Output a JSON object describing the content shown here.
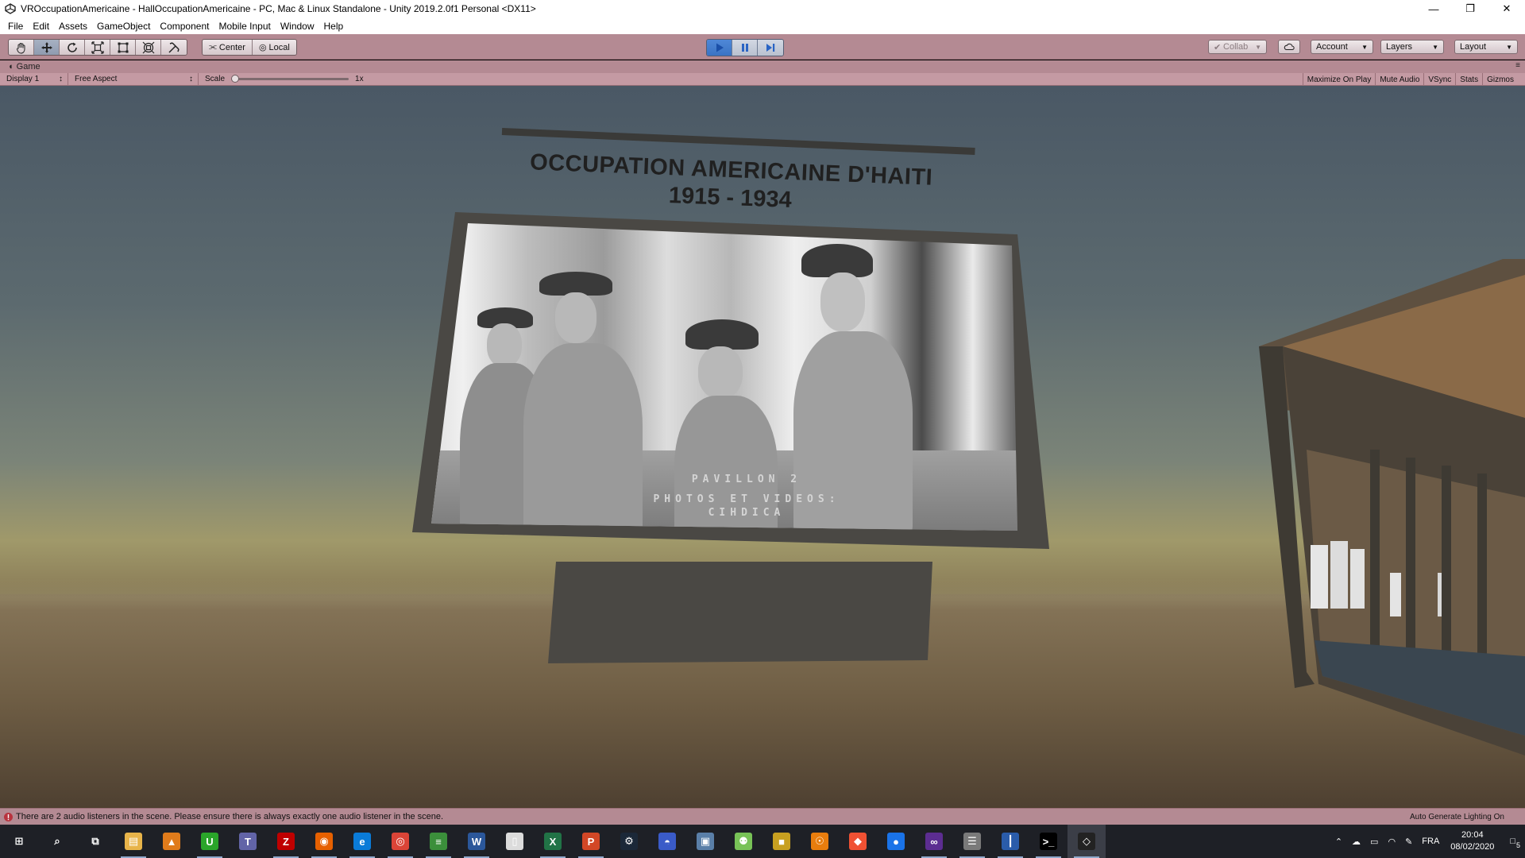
{
  "window": {
    "title": "VROccupationAmericaine - HallOccupationAmericaine - PC, Mac & Linux Standalone - Unity 2019.2.0f1 Personal <DX11>",
    "controls": {
      "minimize": "—",
      "restore": "❐",
      "close": "✕"
    }
  },
  "menubar": {
    "items": [
      "File",
      "Edit",
      "Assets",
      "GameObject",
      "Component",
      "Mobile Input",
      "Window",
      "Help"
    ]
  },
  "toolbar": {
    "tools": [
      "hand-tool",
      "move-tool",
      "rotate-tool",
      "scale-tool",
      "rect-tool",
      "transform-tool",
      "custom-tool"
    ],
    "active_tool": "move-tool",
    "pivot": "Center",
    "space": "Local",
    "play_active": true,
    "collab": "Collab",
    "account": "Account",
    "layers": "Layers",
    "layout": "Layout"
  },
  "game_tab": {
    "label": "Game"
  },
  "game_bar": {
    "display": "Display 1",
    "aspect": "Free Aspect",
    "scale_label": "Scale",
    "scale_value": "1x",
    "scale_level": 0,
    "toggles": [
      "Maximize On Play",
      "Mute Audio",
      "VSync",
      "Stats",
      "Gizmos"
    ]
  },
  "scene": {
    "sign_title_line1": "OCCUPATION AMERICAINE D'HAITI",
    "sign_title_line2": "1915 - 1934",
    "plaque_line1": "PAVILLON 2",
    "plaque_line2": "PHOTOS ET VIDEOS:",
    "plaque_line3": "CIHDICA"
  },
  "statusbar": {
    "message": "There are 2 audio listeners in the scene. Please ensure there is always exactly one audio listener in the scene.",
    "right": "Auto Generate Lighting On"
  },
  "taskbar": {
    "apps": [
      {
        "name": "start-icon",
        "glyph": "⊞",
        "color": "#1e2026"
      },
      {
        "name": "search-icon",
        "glyph": "⌕",
        "color": "#1e2026"
      },
      {
        "name": "task-view-icon",
        "glyph": "⧉",
        "color": "#1e2026"
      },
      {
        "name": "file-explorer-icon",
        "glyph": "▤",
        "color": "#e8b44a"
      },
      {
        "name": "vlc-cone-icon",
        "glyph": "▲",
        "color": "#e07b1b"
      },
      {
        "name": "upwork-icon",
        "glyph": "U",
        "color": "#2aa52a"
      },
      {
        "name": "teams-icon",
        "glyph": "T",
        "color": "#6264a7"
      },
      {
        "name": "filezilla-icon",
        "glyph": "Z",
        "color": "#bf0000"
      },
      {
        "name": "firefox-icon",
        "glyph": "◉",
        "color": "#e66000"
      },
      {
        "name": "edge-icon",
        "glyph": "e",
        "color": "#0a7bd8"
      },
      {
        "name": "chrome-icon",
        "glyph": "◎",
        "color": "#db4437"
      },
      {
        "name": "project-icon",
        "glyph": "≡",
        "color": "#3b8f3b"
      },
      {
        "name": "word-icon",
        "glyph": "W",
        "color": "#2b579a"
      },
      {
        "name": "blank-file-icon",
        "glyph": "▯",
        "color": "#dcdcdc"
      },
      {
        "name": "excel-icon",
        "glyph": "X",
        "color": "#217346"
      },
      {
        "name": "powerpoint-icon",
        "glyph": "P",
        "color": "#d24726"
      },
      {
        "name": "steam-icon",
        "glyph": "⚙",
        "color": "#1b2838"
      },
      {
        "name": "oculus-icon",
        "glyph": "◓",
        "color": "#3a5bc8"
      },
      {
        "name": "monitor-app-icon",
        "glyph": "▣",
        "color": "#5a7fa8"
      },
      {
        "name": "android-icon",
        "glyph": "⚉",
        "color": "#78c257"
      },
      {
        "name": "unity-hub-box-icon",
        "glyph": "■",
        "color": "#c8a020"
      },
      {
        "name": "blender-icon",
        "glyph": "☉",
        "color": "#e87d0d"
      },
      {
        "name": "git-icon",
        "glyph": "◆",
        "color": "#f05133"
      },
      {
        "name": "maps-icon",
        "glyph": "●",
        "color": "#1a73e8"
      },
      {
        "name": "visual-studio-icon",
        "glyph": "∞",
        "color": "#5c2d91"
      },
      {
        "name": "database-icon",
        "glyph": "☰",
        "color": "#7a7a7a"
      },
      {
        "name": "tool-app-icon",
        "glyph": "┃",
        "color": "#2a5caa"
      },
      {
        "name": "terminal-icon",
        "glyph": ">_",
        "color": "#000000"
      },
      {
        "name": "unity-icon",
        "glyph": "◇",
        "color": "#222222"
      }
    ],
    "tray": {
      "language": "FRA",
      "time": "20:04",
      "date": "08/02/2020",
      "notifications": "5"
    }
  }
}
